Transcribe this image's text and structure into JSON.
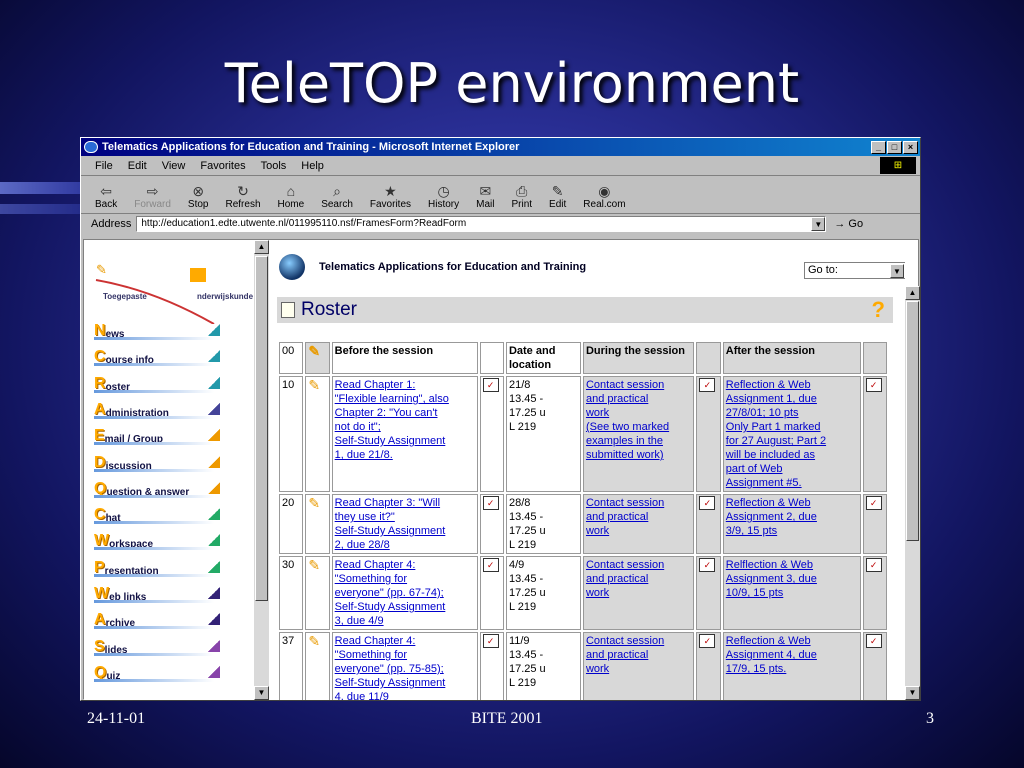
{
  "slide": {
    "title": "TeleTOP environment",
    "date": "24-11-01",
    "event": "BITE 2001",
    "page": "3"
  },
  "window": {
    "title": "Telematics Applications for Education and Training - Microsoft Internet Explorer",
    "menu": [
      "File",
      "Edit",
      "View",
      "Favorites",
      "Tools",
      "Help"
    ],
    "toolbar": [
      "Back",
      "Forward",
      "Stop",
      "Refresh",
      "Home",
      "Search",
      "Favorites",
      "History",
      "Mail",
      "Print",
      "Edit",
      "Real.com"
    ],
    "address_label": "Address",
    "address": "http://education1.edte.utwente.nl/011995110.nsf/FramesForm?ReadForm",
    "go": "Go"
  },
  "logo": {
    "text1": "Toegepaste",
    "text2": "nderwijskunde"
  },
  "nav": [
    {
      "cap": "N",
      "rest": "ews"
    },
    {
      "cap": "C",
      "rest": "ourse info"
    },
    {
      "cap": "R",
      "rest": "oster"
    },
    {
      "cap": "A",
      "rest": "dministration"
    },
    {
      "cap": "E",
      "rest": "mail / Group"
    },
    {
      "cap": "D",
      "rest": "iscussion"
    },
    {
      "cap": "Q",
      "rest": "uestion & answer"
    },
    {
      "cap": "C",
      "rest": "hat"
    },
    {
      "cap": "W",
      "rest": "orkspace"
    },
    {
      "cap": "P",
      "rest": "resentation"
    },
    {
      "cap": "W",
      "rest": "eb links"
    },
    {
      "cap": "A",
      "rest": "rchive"
    },
    {
      "cap": "S",
      "rest": "lides"
    },
    {
      "cap": "Q",
      "rest": "uiz"
    }
  ],
  "main": {
    "header": "Telematics Applications for Education and Training",
    "goto": "Go to:",
    "roster_title": "Roster"
  },
  "table": {
    "headers": {
      "num": "00",
      "before": "Before the session",
      "date": "Date and location",
      "during": "During the session",
      "after": "After the session"
    },
    "rows": [
      {
        "num": "10",
        "before": [
          "Read Chapter 1:",
          "\"Flexible learning\", also",
          "Chapter 2: \"You can't",
          "not do it\";",
          "Self-Study Assignment",
          "1, due 21/8."
        ],
        "date": [
          "21/8",
          "13.45 -",
          "17.25 u",
          "L 219"
        ],
        "during": [
          "Contact session",
          "and practical",
          "work",
          "(See two marked",
          "examples in the",
          "submitted work)"
        ],
        "after": [
          "Reflection & Web",
          "Assignment 1, due",
          "27/8/01; 10 pts",
          "Only Part 1 marked",
          "for 27 August; Part 2",
          "will be included as",
          "part of Web",
          "Assignment #5."
        ]
      },
      {
        "num": "20",
        "before": [
          "Read Chapter 3: \"Will",
          "they use it?\"",
          "Self-Study Assignment",
          "2, due 28/8"
        ],
        "date": [
          "28/8",
          "13.45 -",
          "17.25 u",
          "L 219"
        ],
        "during": [
          "Contact session",
          "and practical",
          "work"
        ],
        "after": [
          "Reflection & Web",
          "Assignment 2, due",
          "3/9, 15 pts"
        ]
      },
      {
        "num": "30",
        "before": [
          "Read Chapter 4:",
          "\"Something for",
          "everyone\" (pp. 67-74);",
          "Self-Study Assignment",
          "3, due 4/9"
        ],
        "date": [
          "4/9",
          "13.45 -",
          "17.25 u",
          "L 219"
        ],
        "during": [
          "Contact session",
          "and practical",
          "work"
        ],
        "after": [
          "Relflection & Web",
          "Assignment 3, due",
          "10/9, 15 pts"
        ]
      },
      {
        "num": "37",
        "before": [
          "Read Chapter 4:",
          "\"Something for",
          "everyone\" (pp. 75-85);",
          "Self-Study Assignment",
          "4, due 11/9"
        ],
        "date": [
          "11/9",
          "13.45 -",
          "17.25 u",
          "L 219"
        ],
        "during": [
          "Contact session",
          "and practical",
          "work"
        ],
        "after": [
          "Reflection & Web",
          "Assignment 4, due",
          "17/9, 15 pts."
        ]
      }
    ]
  }
}
